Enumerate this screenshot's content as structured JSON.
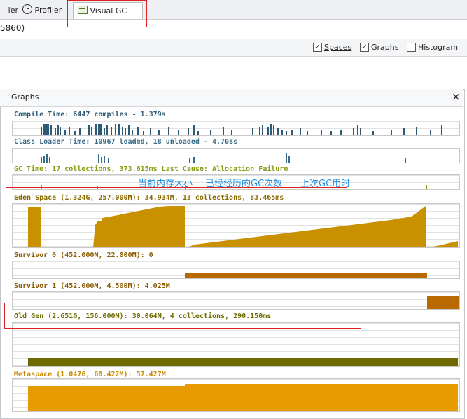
{
  "tabs": [
    {
      "label": "ler",
      "icon": "none"
    },
    {
      "label": "Profiler",
      "icon": "clock-icon"
    },
    {
      "label": "Visual GC",
      "icon": "chart-icon"
    }
  ],
  "process_fragment": "5860)",
  "toolbar": {
    "spaces_label": "Spaces",
    "spaces_checked": true,
    "graphs_label": "Graphs",
    "graphs_checked": true,
    "histogram_label": "Histogram",
    "histogram_checked": false
  },
  "panel": {
    "title": "Graphs",
    "close_symbol": "×"
  },
  "rows": {
    "compile": "Compile Time: 6447 compiles - 1.379s",
    "classloader": "Class Loader Time: 10967 loaded, 18 unloaded - 4.708s",
    "gc": "GC Time: 17 collections, 373.615ms Last Cause: Allocation Failure",
    "eden": "Eden Space (1.324G, 257.000M): 34.934M, 13 collections, 83.465ms",
    "survivor0": "Survivor 0 (452.000M, 22.000M): 0",
    "survivor1": "Survivor 1 (452.000M, 4.500M): 4.025M",
    "oldgen": "Old Gen (2.651G, 156.000M): 30.064M, 4 collections, 290.150ms",
    "metaspace": "Metaspace (1.047G, 60.422M): 57.427M"
  },
  "annotations": {
    "mem_size": "当前内存大小",
    "gc_count": "已经经历的GC次数",
    "last_gc": "上次GC用时"
  },
  "colors": {
    "compile": "#2f5a74",
    "classloader": "#3a6b88",
    "gc": "#8a9a10",
    "eden": "#c99000",
    "survivor": "#b86a00",
    "oldgen": "#6e6a00",
    "metaspace": "#e69b00",
    "highlight": "#e02020",
    "annotation": "#1e8fe0"
  }
}
